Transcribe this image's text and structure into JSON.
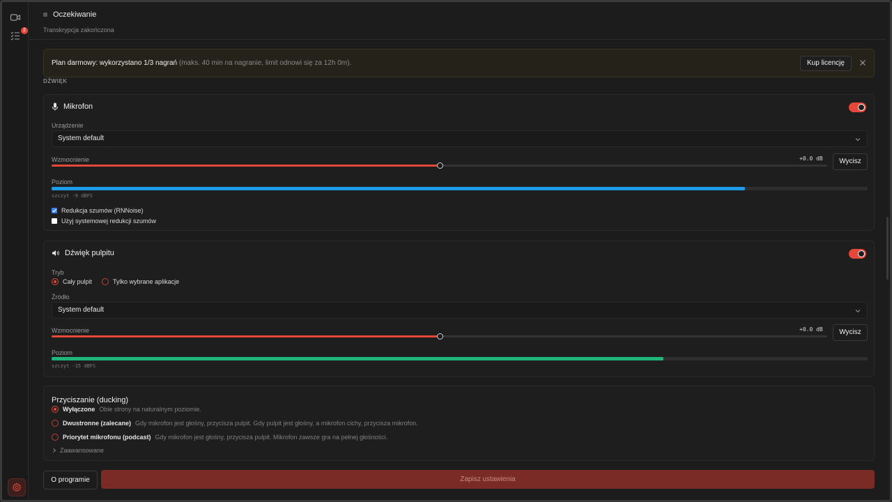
{
  "sidebar": {
    "recordings_icon": "video-camera-icon",
    "tasks_icon": "checklist-icon",
    "tasks_badge": "2",
    "settings_icon": "gear-icon"
  },
  "status": {
    "title": "Oczekiwanie",
    "subtitle": "Transkrypcja zakończona"
  },
  "banner": {
    "strong": "Plan darmowy: wykorzystano 1/3 nagrań",
    "muted": " (maks. 40 min na nagranie, limit odnowi się za 12h 0m).",
    "license_button": "Kup licencję"
  },
  "section_label": "DŹWIĘK",
  "microphone": {
    "title": "Mikrofon",
    "enabled": true,
    "device_label": "Urządzenie",
    "device_value": "System default",
    "gain_label": "Wzmocnienie",
    "gain_value": "+0.0 dB",
    "gain_fraction": 0.5,
    "clear_button": "Wycisz",
    "level_label": "Poziom",
    "level_fraction": 0.85,
    "peak_text": "szczyt -9 dBFS",
    "noise_reduction_label": "Redukcja szumów (RNNoise)",
    "noise_reduction_checked": true,
    "system_noise_label": "Użyj systemowej redukcji szumów",
    "system_noise_checked": false
  },
  "desktop": {
    "title": "Dźwięk pulpitu",
    "enabled": true,
    "mode_label": "Tryb",
    "mode_whole": "Cały pulpit",
    "mode_apps": "Tylko wybrane aplikacje",
    "source_label": "Źródło",
    "source_value": "System default",
    "gain_label": "Wzmocnienie",
    "gain_value": "+0.0 dB",
    "gain_fraction": 0.5,
    "clear_button": "Wycisz",
    "level_label": "Poziom",
    "level_fraction": 0.75,
    "peak_text": "szczyt -15 dBFS"
  },
  "ducking": {
    "title": "Przyciszanie (ducking)",
    "options": [
      {
        "title": "Wyłączone",
        "desc": "Obie strony na naturalnym poziomie.",
        "selected": true
      },
      {
        "title": "Dwustronne (zalecane)",
        "desc": "Gdy mikrofon jest głośny, przycisza pulpit. Gdy pulpit jest głośny, a mikrofon cichy, przycisza mikrofon.",
        "selected": false
      },
      {
        "title": "Priorytet mikrofonu (podcast)",
        "desc": "Gdy mikrofon jest głośny, przycisza pulpit. Mikrofon zawsze gra na pełnej głośności.",
        "selected": false
      }
    ],
    "advanced": "Zaawansowane"
  },
  "footer": {
    "about_button": "O programie",
    "save_button": "Zapisz ustawienia"
  },
  "colors": {
    "accent": "#e5483b",
    "mic_level": "#1e9be9",
    "desktop_level": "#1fb67a"
  }
}
